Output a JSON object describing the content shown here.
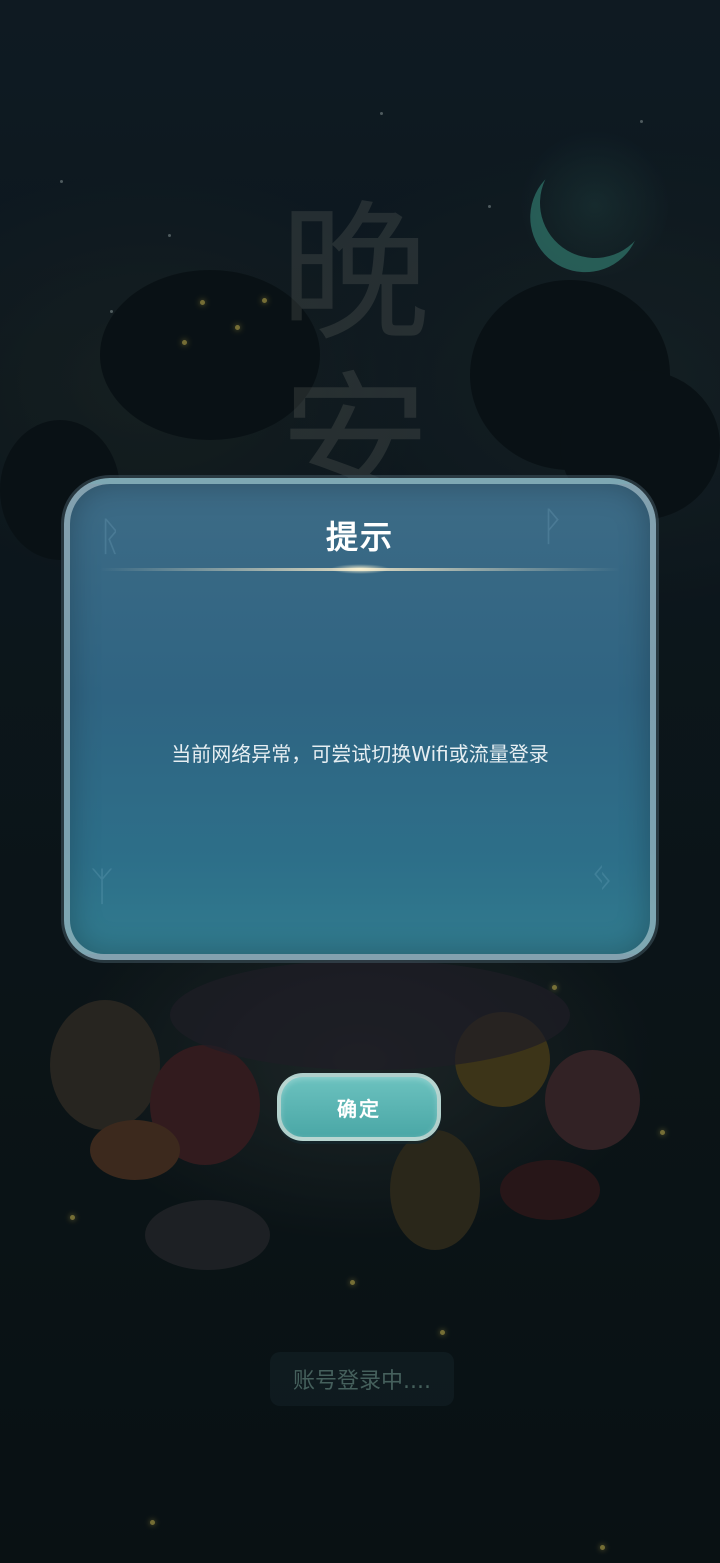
{
  "dialog": {
    "title": "提示",
    "message": "当前网络异常，可尝试切换Wifi或流量登录",
    "confirm_label": "确定"
  },
  "background": {
    "logo_text": "晚安",
    "login_status": "账号登录中...."
  },
  "colors": {
    "dialog_bg": "#2f6482",
    "button_bg": "#4aa7a6",
    "moon": "#3f9a8a"
  }
}
